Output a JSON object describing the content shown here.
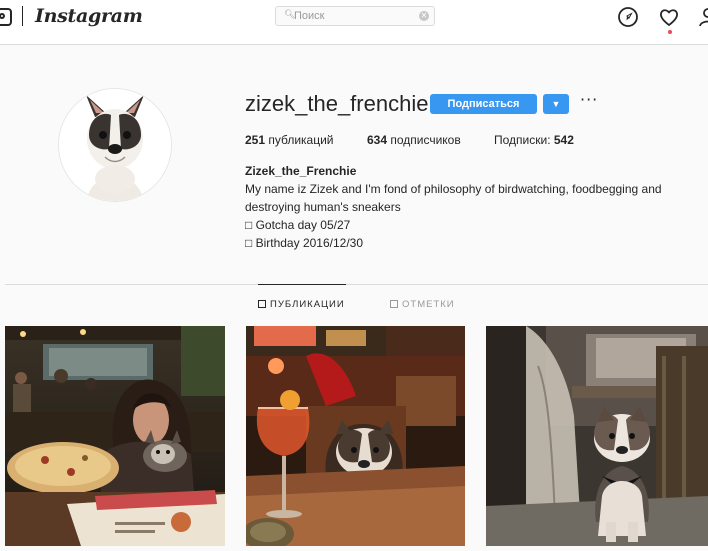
{
  "header": {
    "brand": "Instagram",
    "search_placeholder": "Поиск"
  },
  "profile": {
    "username": "zizek_the_frenchie",
    "follow_label": "Подписаться",
    "stats": {
      "posts_count": "251",
      "posts_label": " публикаций",
      "followers_count": "634",
      "followers_label": " подписчиков",
      "following_label": "Подписки: ",
      "following_count": "542"
    },
    "full_name": "Zizek_the_Frenchie",
    "bio_line1": "My name iz Zizek and I'm fond of philosophy of birdwatching, foodbegging and",
    "bio_line2": "destroying human's sneakers",
    "bio_line3": "□ Gotcha day 05/27",
    "bio_line4": "□ Birthday 2016/12/30"
  },
  "tabs": [
    {
      "label": "ПУБЛИКАЦИИ",
      "active": true
    },
    {
      "label": "ОТМЕТКИ",
      "active": false
    }
  ],
  "colors": {
    "accent": "#3897f0",
    "notification": "#ed4956"
  }
}
